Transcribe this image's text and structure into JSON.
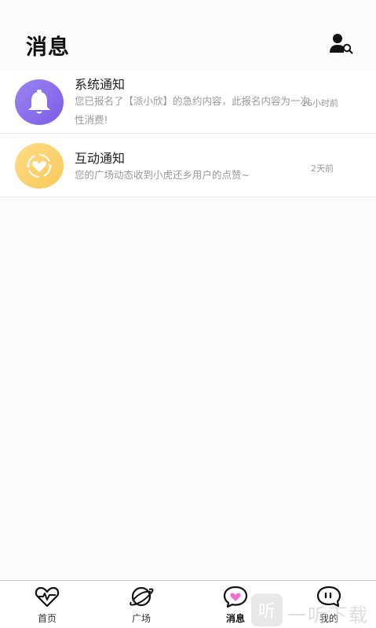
{
  "header": {
    "title": "消息",
    "search_user_icon": "user-search-icon"
  },
  "messages": [
    {
      "title": "系统通知",
      "body": "您已报名了【派小欣】的急约内容，此报名内容为一次性消费!",
      "time": "16小时前",
      "icon": "bell-icon",
      "color": "#8b6cee"
    },
    {
      "title": "互动通知",
      "body": "您的广场动态收到小虎还乡用户的点赞~",
      "time": "2天前",
      "icon": "heart-icon",
      "color": "#fbd36f"
    }
  ],
  "tabs": [
    {
      "label": "首页",
      "icon": "heartbeat-icon"
    },
    {
      "label": "广场",
      "icon": "planet-icon"
    },
    {
      "label": "消息",
      "icon": "chat-heart-icon",
      "active": true
    },
    {
      "label": "我的",
      "icon": "chat-bubble-face-icon"
    }
  ],
  "watermark": {
    "text": "一听下载",
    "glyph": "听"
  }
}
